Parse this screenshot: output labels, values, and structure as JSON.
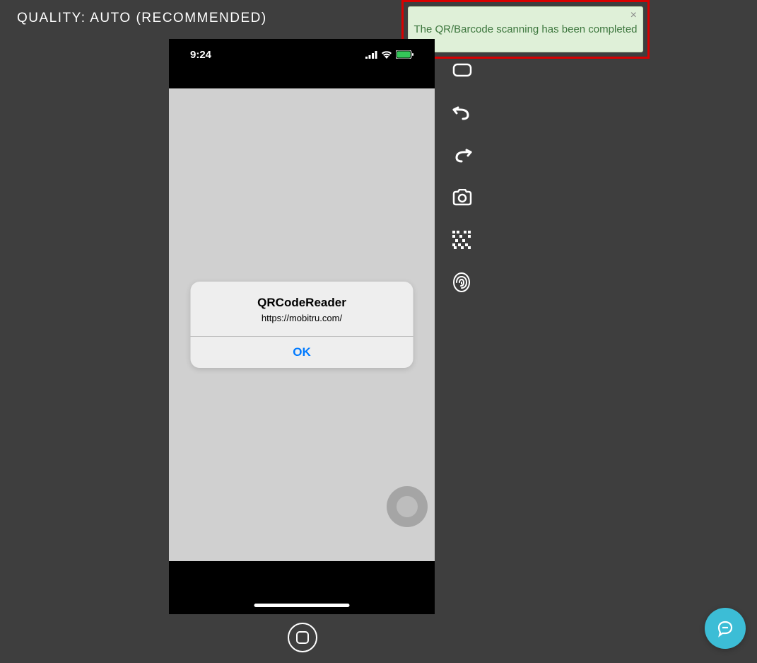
{
  "header": {
    "quality_label": "QUALITY: AUTO (RECOMMENDED)"
  },
  "toast": {
    "message": "The QR/Barcode scanning has been completed",
    "close_symbol": "×"
  },
  "phone": {
    "status_time": "9:24",
    "alert": {
      "title": "QRCodeReader",
      "message": "https://mobitru.com/",
      "ok_label": "OK"
    }
  },
  "toolbar": {
    "items": [
      {
        "name": "rotate-icon"
      },
      {
        "name": "undo-icon"
      },
      {
        "name": "redo-icon"
      },
      {
        "name": "camera-icon"
      },
      {
        "name": "qrcode-icon"
      },
      {
        "name": "fingerprint-icon"
      }
    ]
  }
}
